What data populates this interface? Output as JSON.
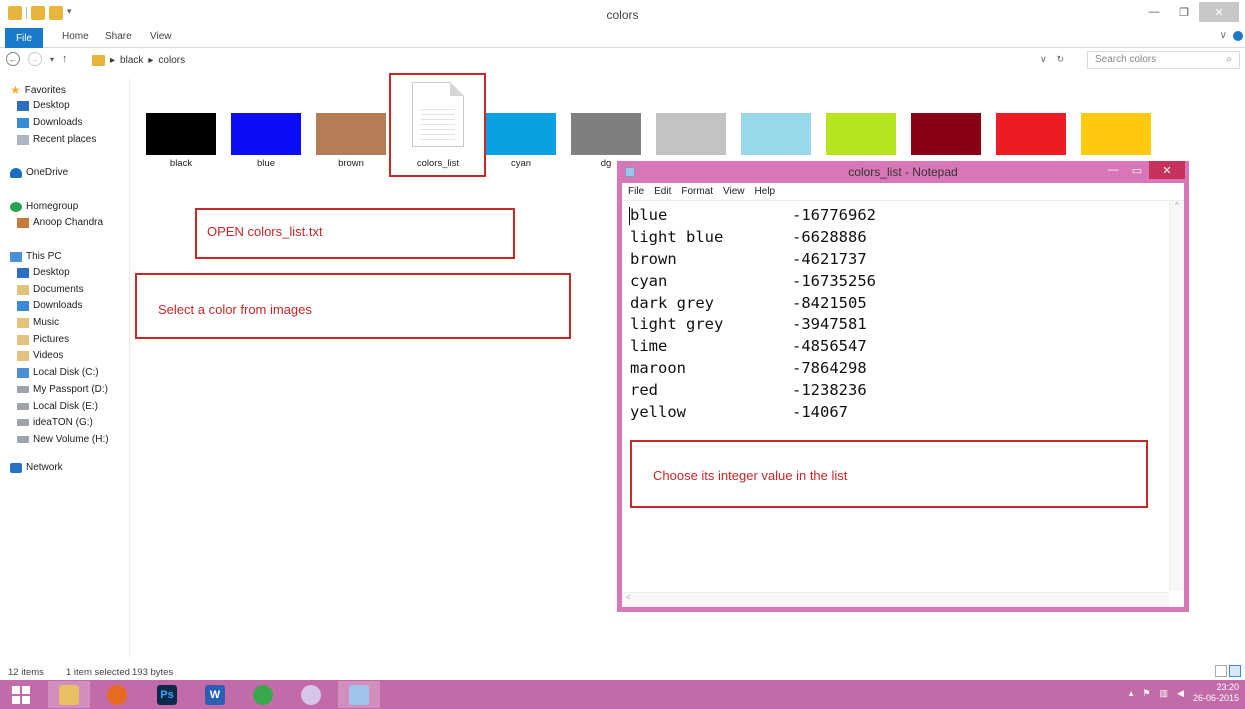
{
  "window": {
    "title": "colors"
  },
  "ribbon": {
    "file": "File",
    "home": "Home",
    "share": "Share",
    "view": "View"
  },
  "address": {
    "crumbs": [
      "black",
      "colors"
    ],
    "search_placeholder": "Search colors"
  },
  "sidebar": {
    "favorites": "Favorites",
    "desktop": "Desktop",
    "downloads": "Downloads",
    "recent": "Recent places",
    "onedrive": "OneDrive",
    "homegroup": "Homegroup",
    "user": "Anoop Chandra",
    "thispc": "This PC",
    "pc_desktop": "Desktop",
    "documents": "Documents",
    "pc_downloads": "Downloads",
    "music": "Music",
    "pictures": "Pictures",
    "videos": "Videos",
    "drive_c": "Local Disk (C:)",
    "drive_d": "My Passport (D:)",
    "drive_e": "Local Disk (E:)",
    "drive_g": "ideaTON (G:)",
    "drive_h": "New Volume (H:)",
    "network": "Network"
  },
  "files": [
    {
      "label": "black",
      "color": "#000000"
    },
    {
      "label": "blue",
      "color": "#0b0ef5"
    },
    {
      "label": "brown",
      "color": "#b57d57"
    },
    {
      "label": "colors_list",
      "color": ""
    },
    {
      "label": "cyan",
      "color": "#0aa1e3"
    },
    {
      "label": "dg",
      "color": "#7f7f7f"
    },
    {
      "label": "",
      "color": "#c3c3c3"
    },
    {
      "label": "",
      "color": "#97d9eb"
    },
    {
      "label": "",
      "color": "#b5e61d"
    },
    {
      "label": "",
      "color": "#880015"
    },
    {
      "label": "",
      "color": "#ed1c24"
    },
    {
      "label": "",
      "color": "#ffc90e"
    }
  ],
  "annotations": {
    "open": "OPEN colors_list.txt",
    "select": "Select a color from images",
    "choose": "Choose its integer value in the list"
  },
  "notepad": {
    "title": "colors_list - Notepad",
    "menu": [
      "File",
      "Edit",
      "Format",
      "View",
      "Help"
    ],
    "rows": [
      {
        "name": "blue",
        "value": "-16776962"
      },
      {
        "name": "light blue",
        "value": "-6628886"
      },
      {
        "name": "brown",
        "value": "-4621737"
      },
      {
        "name": "cyan",
        "value": "-16735256"
      },
      {
        "name": "dark grey",
        "value": "-8421505"
      },
      {
        "name": "light grey",
        "value": "-3947581"
      },
      {
        "name": "lime",
        "value": "-4856547"
      },
      {
        "name": "maroon",
        "value": "-7864298"
      },
      {
        "name": "red",
        "value": "-1238236"
      },
      {
        "name": "yellow",
        "value": "-14067"
      }
    ]
  },
  "status": {
    "items": "12 items",
    "selected": "1 item selected",
    "size": "193 bytes"
  },
  "taskbar": {
    "time": "23:20",
    "date": "26-06-2015",
    "ps": "Ps",
    "word": "W"
  }
}
